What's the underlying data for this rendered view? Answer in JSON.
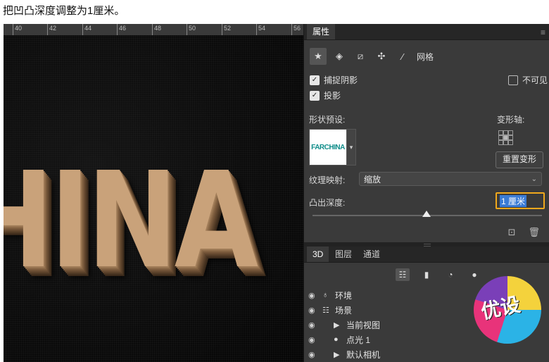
{
  "caption": "把凹凸深度调整为1厘米。",
  "ruler": {
    "labels": [
      "40",
      "42",
      "44",
      "46",
      "48",
      "50",
      "52",
      "54",
      "56"
    ]
  },
  "canvas": {
    "artwork_text": "HINA"
  },
  "properties_panel": {
    "tab": "属性",
    "toolbar_label": "网格",
    "catch_shadows": "捕捉阴影",
    "invisible": "不可见",
    "cast_shadows": "投影",
    "shape_preset_label": "形状预设:",
    "preset_thumbnail_text": "FARCHINA",
    "deform_axis_label": "变形轴:",
    "reset_deform_button": "重置变形",
    "texture_mapping_label": "纹理映射:",
    "texture_mapping_value": "缩放",
    "extrusion_depth_label": "凸出深度:",
    "extrusion_depth_value": "1 厘米"
  },
  "layers_panel": {
    "tabs": [
      "3D",
      "图层",
      "通道"
    ],
    "items": [
      {
        "label": "环境"
      },
      {
        "label": "场景"
      },
      {
        "label": "当前视图"
      },
      {
        "label": "点光 1"
      },
      {
        "label": "默认相机"
      }
    ]
  },
  "watermark": {
    "text": "优设"
  }
}
